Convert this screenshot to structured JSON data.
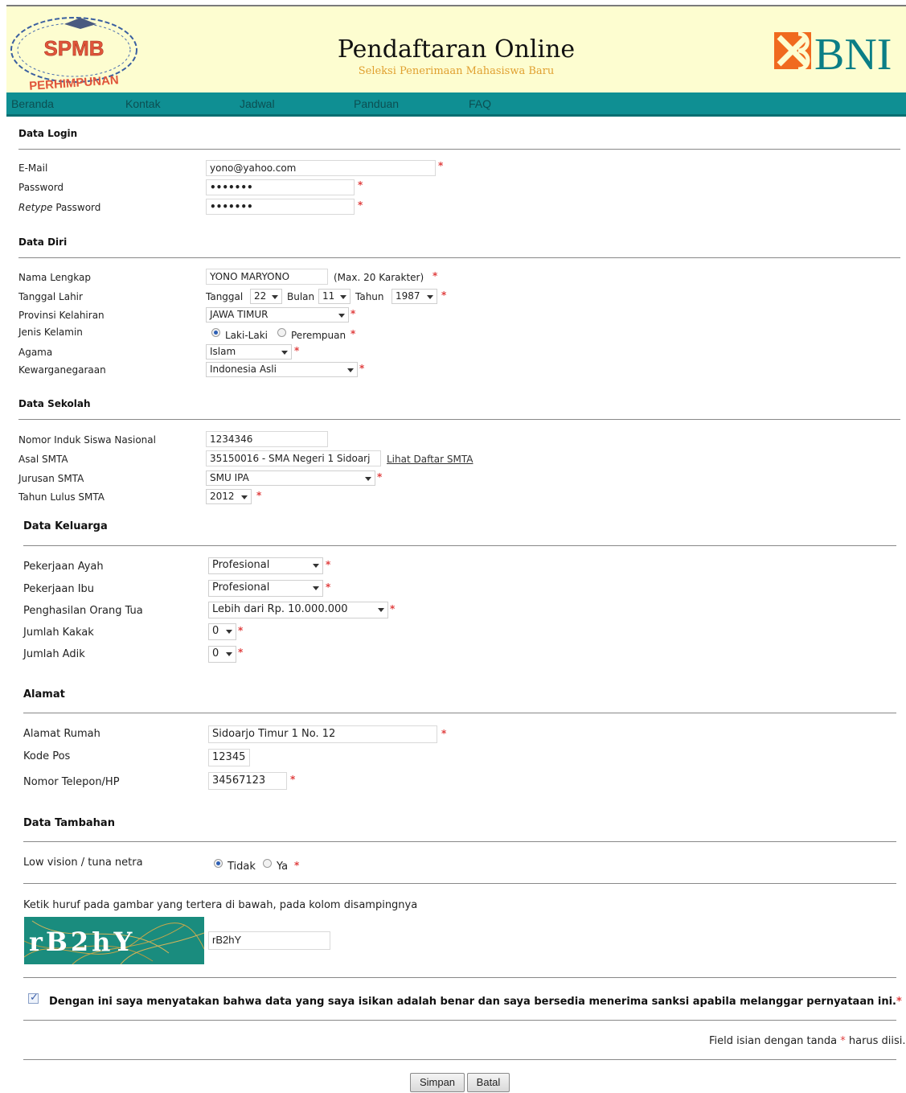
{
  "header": {
    "logo_top_text": "SPMB",
    "logo_bottom_text": "PERHIMPUNAN",
    "title": "Pendaftaran Online",
    "subtitle": "Seleksi Penerimaan Mahasiswa Baru",
    "bank_logo_text": "BNI"
  },
  "nav": {
    "items": [
      {
        "label": "Beranda"
      },
      {
        "label": "Kontak"
      },
      {
        "label": "Jadwal"
      },
      {
        "label": "Panduan"
      },
      {
        "label": "FAQ"
      }
    ]
  },
  "required_mark": "*",
  "login": {
    "section": "Data Login",
    "email_label": "E-Mail",
    "email_value": "yono@yahoo.com",
    "password_label": "Password",
    "password_value": "•••••••",
    "retype_label_italic": "Retype",
    "retype_label_rest": " Password",
    "retype_value": "•••••••"
  },
  "diri": {
    "section": "Data Diri",
    "nama_label": "Nama Lengkap",
    "nama_value": "YONO MARYONO",
    "nama_hint": "(Max. 20 Karakter)",
    "lahir_label": "Tanggal Lahir",
    "tanggal_label": "Tanggal",
    "tanggal_value": "22",
    "bulan_label": "Bulan",
    "bulan_value": "11",
    "tahun_label": "Tahun",
    "tahun_value": "1987",
    "provinsi_label": "Provinsi Kelahiran",
    "provinsi_value": "JAWA TIMUR",
    "kelamin_label": "Jenis Kelamin",
    "kelamin_option_1": "Laki-Laki",
    "kelamin_option_2": "Perempuan",
    "agama_label": "Agama",
    "agama_value": "Islam",
    "warga_label": "Kewarganegaraan",
    "warga_value": "Indonesia Asli"
  },
  "sekolah": {
    "section": "Data Sekolah",
    "nisn_label": "Nomor Induk Siswa Nasional",
    "nisn_value": "1234346",
    "asal_label": "Asal SMTA",
    "asal_value": "35150016 - SMA Negeri  1 Sidoarj",
    "asal_link": "Lihat Daftar SMTA",
    "jurusan_label": "Jurusan SMTA",
    "jurusan_value": "SMU IPA",
    "lulus_label": "Tahun Lulus SMTA",
    "lulus_value": "2012"
  },
  "keluarga": {
    "section": "Data Keluarga",
    "ayah_label": "Pekerjaan Ayah",
    "ayah_value": "Profesional",
    "ibu_label": "Pekerjaan Ibu",
    "ibu_value": "Profesional",
    "penghasilan_label": "Penghasilan Orang Tua",
    "penghasilan_value": "Lebih dari Rp. 10.000.000",
    "kakak_label": "Jumlah Kakak",
    "kakak_value": "0",
    "adik_label": "Jumlah Adik",
    "adik_value": "0"
  },
  "alamat": {
    "section": "Alamat",
    "rumah_label": "Alamat Rumah",
    "rumah_value": "Sidoarjo Timur 1 No. 12",
    "pos_label": "Kode Pos",
    "pos_value": "12345",
    "telp_label": "Nomor Telepon/HP",
    "telp_value": "34567123"
  },
  "tambahan": {
    "section": "Data Tambahan",
    "lowvision_label": "Low vision / tuna netra",
    "option_tidak": "Tidak",
    "option_ya": "Ya"
  },
  "captcha": {
    "instruction": "Ketik huruf pada gambar yang tertera di bawah, pada kolom disampingnya",
    "image_text": "rB2hY",
    "input_value": "rB2hY"
  },
  "agreement": {
    "statement": "Dengan ini saya menyatakan bahwa data yang saya isikan adalah benar dan saya bersedia menerima sanksi apabila melanggar pernyataan ini."
  },
  "footer": {
    "note_before": "Field isian dengan tanda",
    "note_after": "harus diisi.",
    "save_label": "Simpan",
    "cancel_label": "Batal"
  },
  "colors": {
    "header_bg": "#fdfdd0",
    "nav_bg": "#0f8f93",
    "required": "#e04040",
    "subtitle": "#e0a030",
    "bni_orange": "#f06a1f",
    "bni_teal": "#0b7e86"
  }
}
